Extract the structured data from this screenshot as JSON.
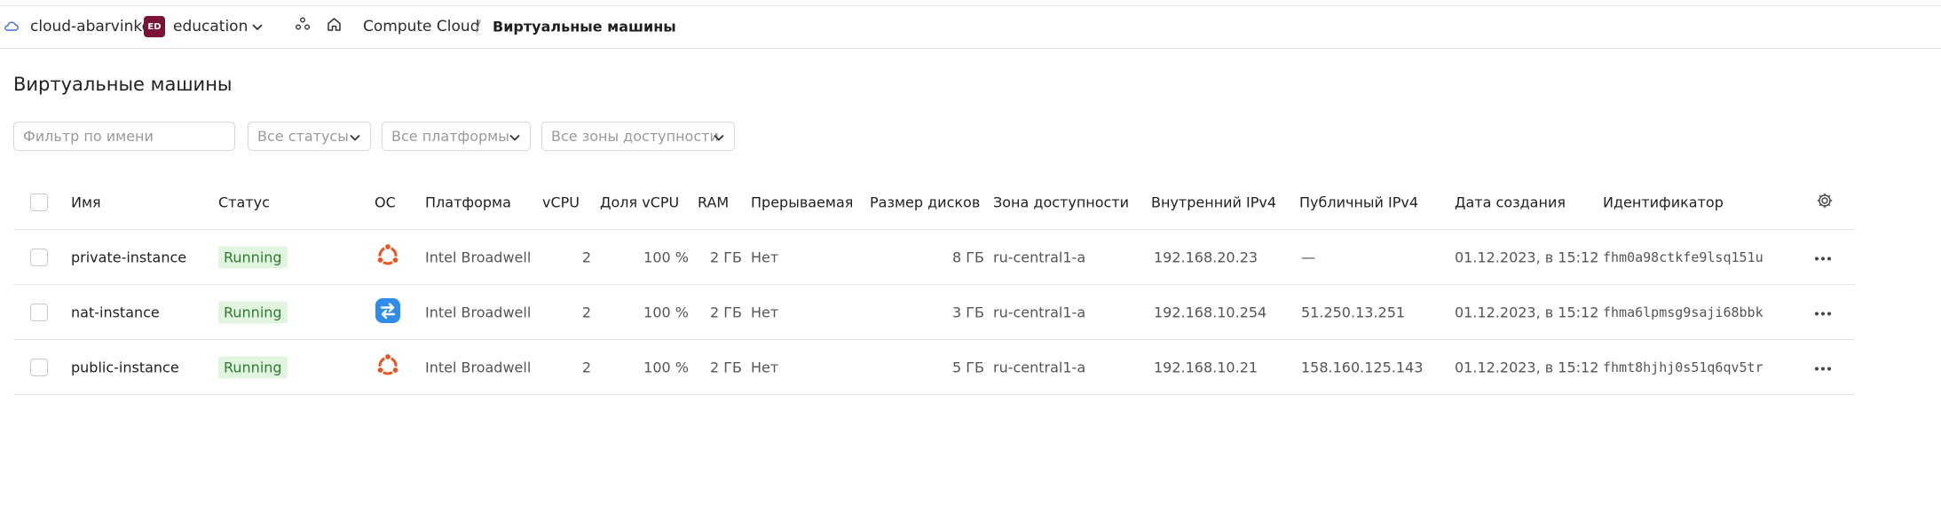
{
  "header": {
    "cloud_name": "cloud-abarvinko",
    "folder_badge": "ED",
    "folder_name": "education",
    "breadcrumb_service": "Compute Cloud",
    "breadcrumb_separator": "/",
    "breadcrumb_current": "Виртуальные машины"
  },
  "page": {
    "title": "Виртуальные машины"
  },
  "filters": {
    "name_placeholder": "Фильтр по имени",
    "status": "Все статусы",
    "platform": "Все платформы",
    "zone": "Все зоны доступности"
  },
  "table": {
    "columns": {
      "name": "Имя",
      "status": "Статус",
      "os": "ОС",
      "platform": "Платформа",
      "vcpu": "vCPU",
      "vcpu_share": "Доля vCPU",
      "ram": "RAM",
      "preemptible": "Прерываемая",
      "disk_size": "Размер дисков",
      "zone": "Зона доступности",
      "internal_ip": "Внутренний IPv4",
      "public_ip": "Публичный IPv4",
      "created": "Дата создания",
      "id": "Идентификатор"
    },
    "rows": [
      {
        "name": "private-instance",
        "status": "Running",
        "os_icon": "ubuntu-icon",
        "platform": "Intel Broadwell",
        "vcpu": "2",
        "vcpu_share": "100 %",
        "ram": "2 ГБ",
        "preemptible": "Нет",
        "disk_size": "8 ГБ",
        "zone": "ru-central1-a",
        "internal_ip": "192.168.20.23",
        "public_ip": "—",
        "created": "01.12.2023, в 15:12",
        "id": "fhm0a98ctkfe9lsq151u"
      },
      {
        "name": "nat-instance",
        "status": "Running",
        "os_icon": "nat-icon",
        "platform": "Intel Broadwell",
        "vcpu": "2",
        "vcpu_share": "100 %",
        "ram": "2 ГБ",
        "preemptible": "Нет",
        "disk_size": "3 ГБ",
        "zone": "ru-central1-a",
        "internal_ip": "192.168.10.254",
        "public_ip": "51.250.13.251",
        "created": "01.12.2023, в 15:12",
        "id": "fhma6lpmsg9saji68bbk"
      },
      {
        "name": "public-instance",
        "status": "Running",
        "os_icon": "ubuntu-icon",
        "platform": "Intel Broadwell",
        "vcpu": "2",
        "vcpu_share": "100 %",
        "ram": "2 ГБ",
        "preemptible": "Нет",
        "disk_size": "5 ГБ",
        "zone": "ru-central1-a",
        "internal_ip": "192.168.10.21",
        "public_ip": "158.160.125.143",
        "created": "01.12.2023, в 15:12",
        "id": "fhmt8hjhj0s51q6qv5tr"
      }
    ]
  },
  "colors": {
    "status_running_bg": "#e0f4e0",
    "status_running_text": "#2f7a30",
    "folder_badge_bg": "#7a1437",
    "ubuntu_orange": "#e95420",
    "nat_blue": "#2f8ce8"
  }
}
